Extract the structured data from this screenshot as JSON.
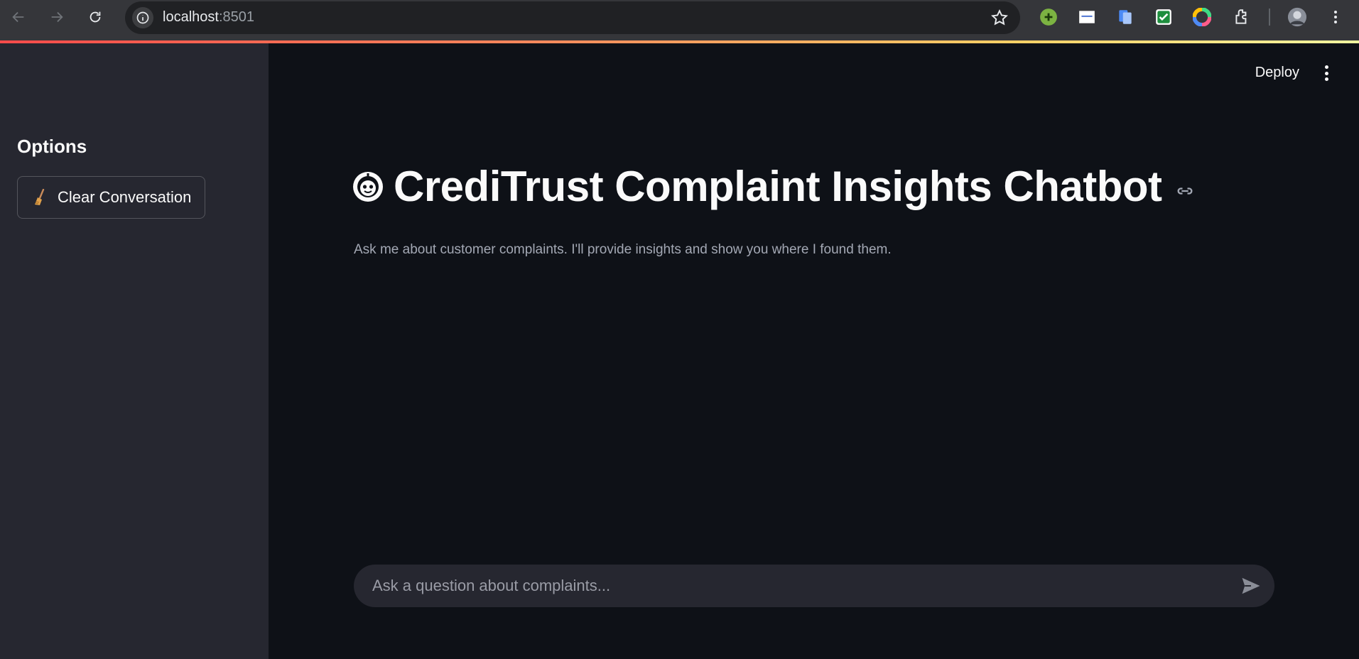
{
  "browser": {
    "url_host": "localhost",
    "url_port": ":8501",
    "icons": [
      "back-icon",
      "forward-icon",
      "reload-icon",
      "site-info-icon",
      "bookmark-star-icon",
      "extensions-icon",
      "profile-avatar",
      "menu-icon"
    ]
  },
  "sidebar": {
    "heading": "Options",
    "clear_button_icon": "broom-icon",
    "clear_button_label": "Clear Conversation"
  },
  "header": {
    "deploy_label": "Deploy"
  },
  "main": {
    "title_icon": "robot-icon",
    "title": "CrediTrust Complaint Insights Chatbot",
    "subtitle": "Ask me about customer complaints. I'll provide insights and show you where I found them."
  },
  "chat": {
    "placeholder": "Ask a question about complaints...",
    "value": ""
  },
  "colors": {
    "main_bg": "#0e1117",
    "sidebar_bg": "#262730",
    "text": "#fafafa",
    "muted_text": "#a3a8b4"
  }
}
